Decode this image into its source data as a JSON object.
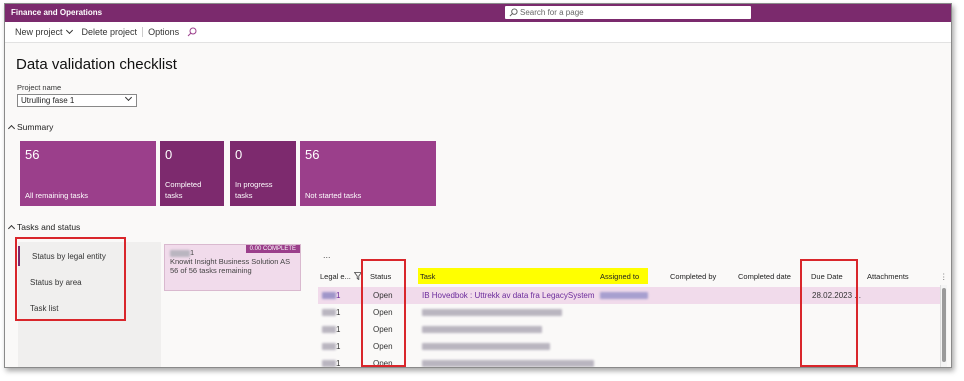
{
  "app": {
    "title": "Finance and Operations",
    "search_placeholder": "Search for a page"
  },
  "actionbar": {
    "new_project": "New project",
    "delete_project": "Delete project",
    "options": "Options"
  },
  "page": {
    "title": "Data validation checklist"
  },
  "project": {
    "label": "Project name",
    "value": "Utrulling fase 1"
  },
  "summary": {
    "heading": "Summary",
    "tiles": [
      {
        "num": "56",
        "label": "All remaining tasks"
      },
      {
        "num": "0",
        "label": "Completed tasks"
      },
      {
        "num": "0",
        "label": "In progress tasks"
      },
      {
        "num": "56",
        "label": "Not started tasks"
      }
    ]
  },
  "tasks_status": {
    "heading": "Tasks and status",
    "nav": [
      "Status by legal entity",
      "Status by area",
      "Task list"
    ]
  },
  "entity_card": {
    "id_suffix": "1",
    "badge": "0.00 COMPLETE",
    "name": "Knowit Insight Business Solution AS",
    "remaining": "56 of 56 tasks remaining"
  },
  "grid": {
    "more": "...",
    "columns": {
      "legal_entity": "Legal e...",
      "status": "Status",
      "task": "Task",
      "assigned_to": "Assigned to",
      "completed_by": "Completed by",
      "completed_date": "Completed date",
      "due_date": "Due Date",
      "attachments": "Attachments"
    },
    "rows": [
      {
        "legal": "1",
        "status": "Open",
        "task": "IB Hovedbok : Uttrekk av data fra LegacySystem",
        "due": "28.02.2023 ..."
      },
      {
        "legal": "1",
        "status": "Open",
        "task": "",
        "due": ""
      },
      {
        "legal": "1",
        "status": "Open",
        "task": "",
        "due": ""
      },
      {
        "legal": "1",
        "status": "Open",
        "task": "",
        "due": ""
      },
      {
        "legal": "1",
        "status": "Open",
        "task": "",
        "due": ""
      }
    ]
  },
  "colors": {
    "brand": "#7b2a6d",
    "tile_light": "#9b3f8b",
    "highlight": "#ffff00",
    "annotation_red": "#d9262b"
  }
}
